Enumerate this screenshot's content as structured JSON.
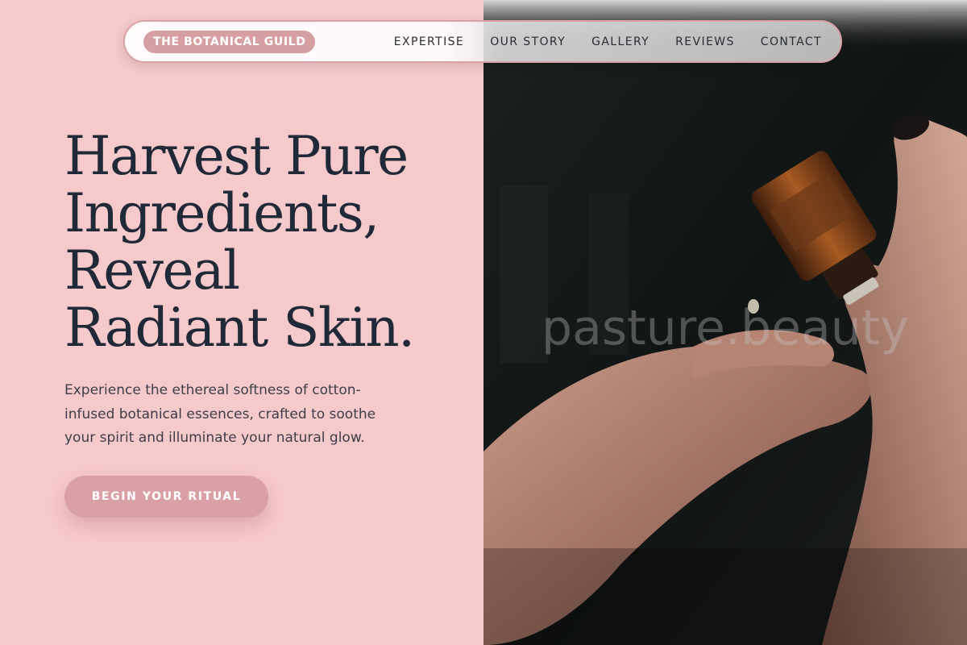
{
  "nav": {
    "brand": "THE BOTANICAL GUILD",
    "links": [
      "EXPERTISE",
      "OUR STORY",
      "GALLERY",
      "REVIEWS",
      "CONTACT"
    ]
  },
  "hero": {
    "headline_lines": [
      "Harvest Pure",
      "Ingredients,",
      "Reveal",
      "Radiant Skin."
    ],
    "subtext": "Experience the ethereal softness of cotton-infused botanical essences, crafted to soothe your spirit and illuminate your natural glow.",
    "cta_label": "BEGIN YOUR RITUAL"
  },
  "image": {
    "watermark": "pasture.beauty"
  },
  "colors": {
    "background": "#f6c9ca",
    "accent": "#d9a1a5",
    "headline": "#1f2938"
  }
}
